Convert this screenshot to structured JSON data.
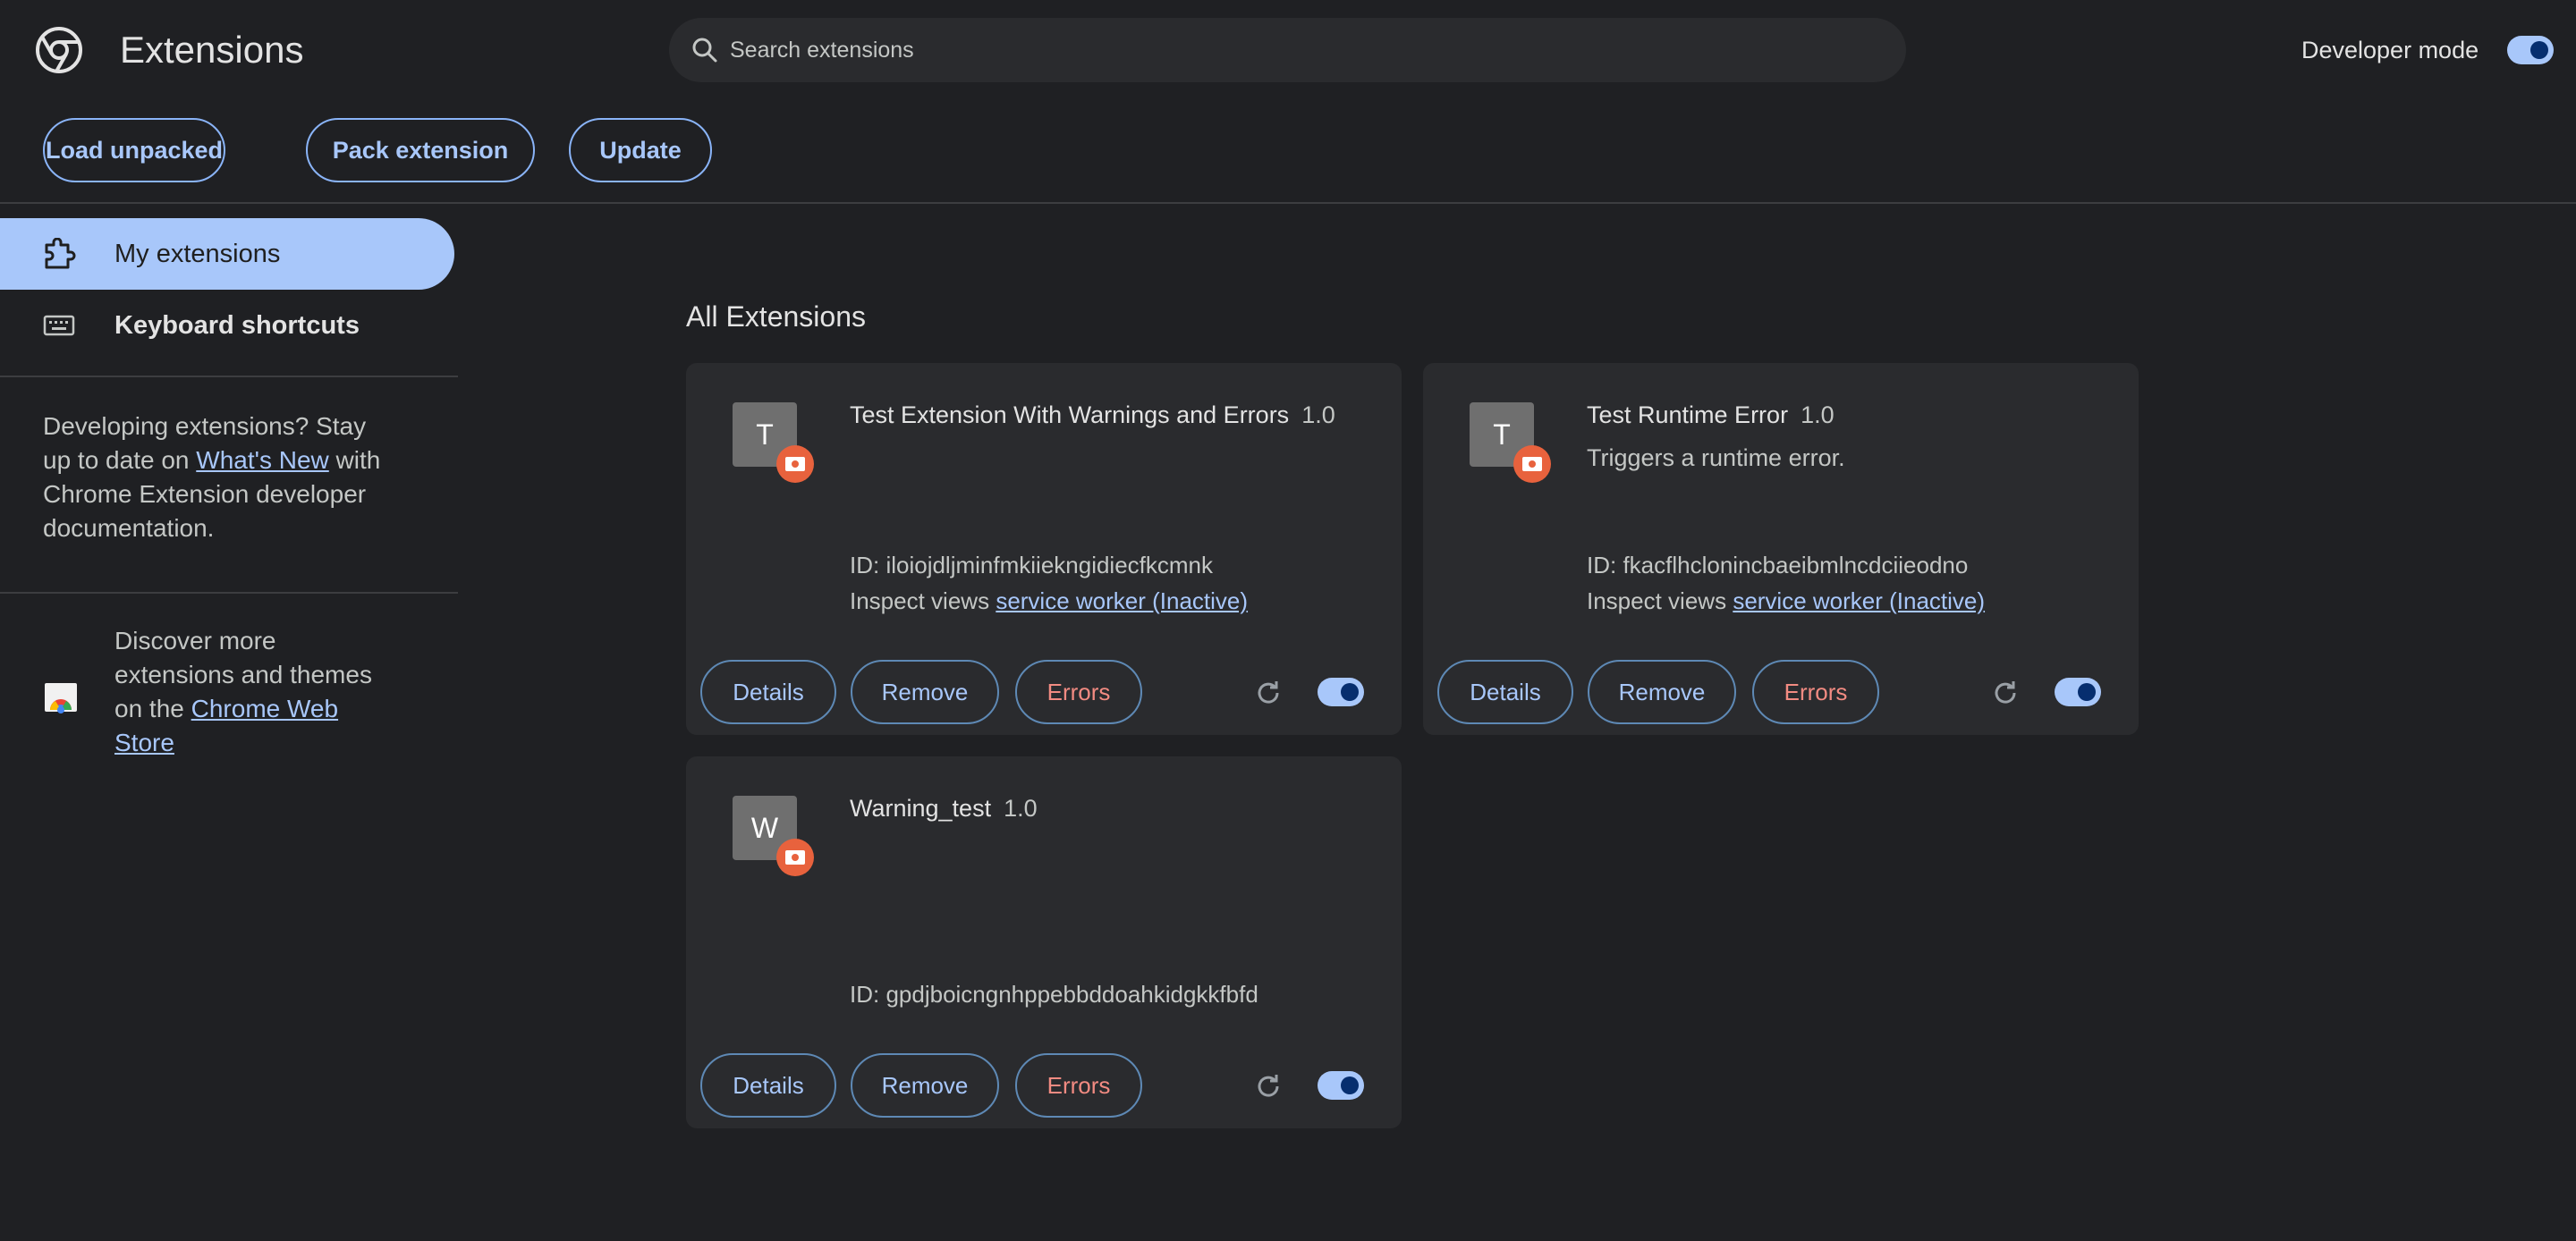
{
  "header": {
    "title": "Extensions",
    "search_placeholder": "Search extensions",
    "developer_mode_label": "Developer mode",
    "developer_mode_on": true
  },
  "toolbar": {
    "load_unpacked": "Load unpacked",
    "pack_extension": "Pack extension",
    "update": "Update"
  },
  "sidebar": {
    "items": [
      {
        "label": "My extensions",
        "icon": "puzzle-icon",
        "active": true
      },
      {
        "label": "Keyboard shortcuts",
        "icon": "keyboard-icon",
        "active": false
      }
    ],
    "developing": {
      "line1": "Developing extensions? Stay",
      "line2_pre": "up to date on ",
      "line2_link": "What's New",
      "line2_post": " with",
      "line3": "Chrome Extension developer",
      "line4": "documentation."
    },
    "discover": {
      "line1": "Discover more",
      "line2": "extensions and themes",
      "line3_pre": "on the ",
      "line3_link": "Chrome Web",
      "line4_link": "Store"
    }
  },
  "main": {
    "section_title": "All Extensions",
    "extensions": [
      {
        "icon_letter": "T",
        "name": "Test Extension With Warnings and Errors",
        "version": "1.0",
        "description": "",
        "id_text": "ID: iloiojdljminfmkiiekngidiecfkcmnk",
        "inspect_label": "Inspect views",
        "inspect_link": "service worker (Inactive)",
        "details": "Details",
        "remove": "Remove",
        "errors": "Errors",
        "enabled": true
      },
      {
        "icon_letter": "T",
        "name": "Test Runtime Error",
        "version": "1.0",
        "description": "Triggers a runtime error.",
        "id_text": "ID: fkacflhcloninc​baeibmlncdciieodno",
        "inspect_label": "Inspect views",
        "inspect_link": "service worker (Inactive)",
        "details": "Details",
        "remove": "Remove",
        "errors": "Errors",
        "enabled": true
      },
      {
        "icon_letter": "W",
        "name": "Warning_test",
        "version": "1.0",
        "description": "",
        "id_text": "ID: gpdjboicngnhppebbddoahkidgkkfbfd",
        "inspect_label": "",
        "inspect_link": "",
        "details": "Details",
        "remove": "Remove",
        "errors": "Errors",
        "enabled": true
      }
    ]
  },
  "colors": {
    "background": "#1f2023",
    "card": "#2a2b2e",
    "accent": "#a8c7fa",
    "error": "#f28b82",
    "badge": "#e8623d"
  }
}
